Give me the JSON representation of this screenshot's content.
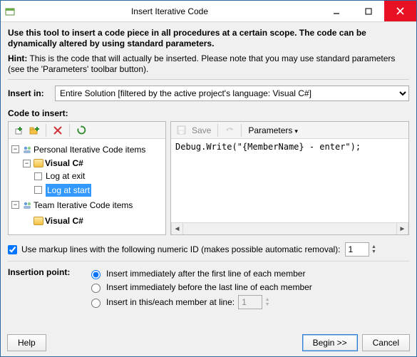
{
  "title": "Insert Iterative Code",
  "intro": "Use this tool to insert a code piece in all procedures at a certain scope. The code can be dynamically altered by using standard parameters.",
  "hint_label": "Hint:",
  "hint_text": "This is the code that will actually be inserted. Please note that you may use standard parameters (see the 'Parameters' toolbar button).",
  "insert_in_label": "Insert in:",
  "insert_in_value": "Entire Solution [filtered by the active project's language: Visual C#]",
  "code_label": "Code to insert:",
  "left_toolbar": {
    "add": "add-node-icon",
    "addfolder": "add-folder-icon",
    "delete": "delete-icon",
    "refresh": "refresh-icon"
  },
  "right_toolbar": {
    "save": "Save",
    "undo": "undo-icon",
    "parameters": "Parameters"
  },
  "tree": {
    "personal": {
      "label": "Personal Iterative Code items",
      "lang": "Visual C#",
      "items": [
        "Log at exit",
        "Log at start"
      ],
      "selected": "Log at start"
    },
    "team": {
      "label": "Team Iterative Code items",
      "lang": "Visual C#"
    }
  },
  "code_text": "Debug.Write(\"{MemberName} - enter\");",
  "markup_checkbox": "Use markup lines with the following numeric ID (makes possible automatic removal):",
  "markup_value": "1",
  "insertion_label": "Insertion point:",
  "radios": {
    "r1": "Insert immediately after the first line of each member",
    "r2": "Insert immediately before the last line of each member",
    "r3": "Insert in this/each member at line:"
  },
  "line_value": "1",
  "buttons": {
    "help": "Help",
    "begin": "Begin >>",
    "cancel": "Cancel"
  }
}
